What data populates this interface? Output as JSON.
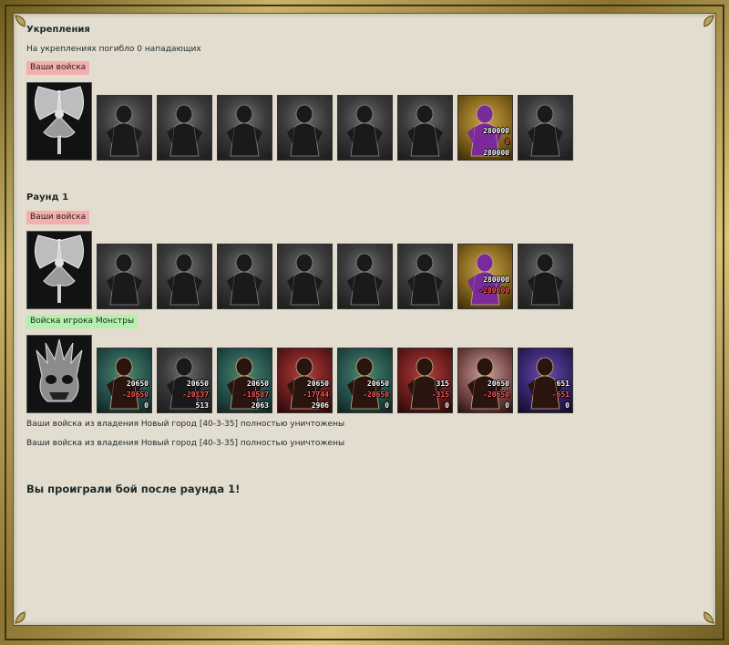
{
  "fortifications": {
    "title": "Укрепления",
    "killed_text": "На укреплениях погибло 0 нападающих",
    "your_troops_label": "Ваши войска",
    "units": [
      {
        "style": "gray"
      },
      {
        "style": "gray"
      },
      {
        "style": "gray"
      },
      {
        "style": "gray"
      },
      {
        "style": "gray"
      },
      {
        "style": "gray"
      },
      {
        "style": "gold",
        "count": "280000",
        "loss": "0",
        "remain": "280000"
      },
      {
        "style": "gray"
      }
    ]
  },
  "round1": {
    "title": "Раунд 1",
    "your_troops_label": "Ваши войска",
    "your_units": [
      {
        "style": "gray"
      },
      {
        "style": "gray"
      },
      {
        "style": "gray"
      },
      {
        "style": "gray"
      },
      {
        "style": "gray"
      },
      {
        "style": "gray"
      },
      {
        "style": "gold",
        "count": "280000",
        "loss": "-280000",
        "remain": ""
      },
      {
        "style": "gray"
      }
    ],
    "enemy_label": "Войска игрока Монстры",
    "enemy_units": [
      {
        "style": "m-green",
        "count": "20650",
        "loss": "-20650",
        "remain": "0"
      },
      {
        "style": "gray",
        "count": "20650",
        "loss": "-20137",
        "remain": "513"
      },
      {
        "style": "m-green",
        "count": "20650",
        "loss": "-18587",
        "remain": "2063"
      },
      {
        "style": "m-red",
        "count": "20650",
        "loss": "-17744",
        "remain": "2906"
      },
      {
        "style": "m-green",
        "count": "20650",
        "loss": "-20650",
        "remain": "0"
      },
      {
        "style": "m-red",
        "count": "315",
        "loss": "-315",
        "remain": "0"
      },
      {
        "style": "m-pale",
        "count": "20650",
        "loss": "-20650",
        "remain": "0"
      },
      {
        "style": "m-purple",
        "count": "651",
        "loss": "-651",
        "remain": "0"
      }
    ]
  },
  "messages": [
    "Ваши войска из владения Новый город [40-3-35] полностью уничтожены",
    "Ваши войска из владения Новый город [40-3-35] полностью уничтожены"
  ],
  "result": "Вы проиграли бой после раунда 1!"
}
